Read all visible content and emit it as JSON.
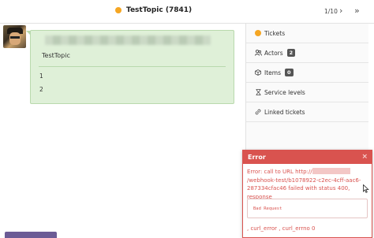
{
  "header": {
    "title": "TestTopic (7841)",
    "pager": "1/10",
    "next_icon": "chevron-right-icon",
    "last_icon": "double-chevron-right-icon",
    "status_color": "#f5a623"
  },
  "message": {
    "title": "TestTopic",
    "line1": "1",
    "line2": "2",
    "background": "#dff0d8"
  },
  "sidebar": {
    "items": [
      {
        "label": "Tickets",
        "icon": "orange-dot-icon"
      },
      {
        "label": "Actors",
        "icon": "users-icon",
        "count": "2"
      },
      {
        "label": "Items",
        "icon": "box-icon",
        "count": "0"
      },
      {
        "label": "Service levels",
        "icon": "hourglass-icon"
      },
      {
        "label": "Linked tickets",
        "icon": "link-icon"
      }
    ]
  },
  "toast": {
    "title": "Error",
    "body_prefix": "Error: call to URL http://",
    "body_suffix": "/webhook-test/b1078922-c2ec-4cff-aac6-287334cfac46 failed with status 400, response",
    "response": "Bad Request",
    "footer": ", curl_error , curl_errno 0",
    "color": "#d9534f"
  }
}
